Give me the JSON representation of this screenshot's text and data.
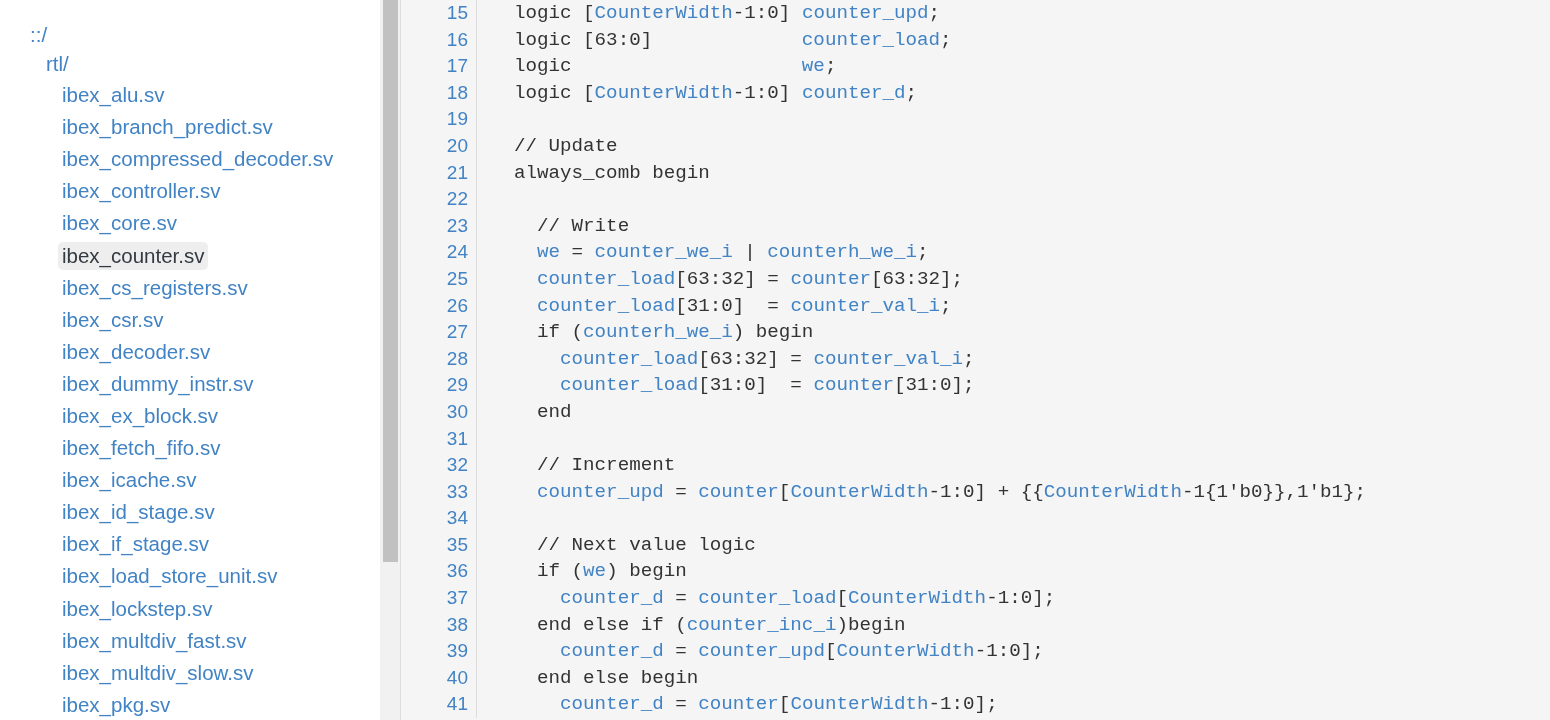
{
  "file_tree": [
    {
      "label": "::/",
      "kind": "folder",
      "selected": false,
      "children": [
        {
          "label": "rtl/",
          "kind": "folder",
          "selected": false,
          "children": [
            {
              "label": "ibex_alu.sv",
              "kind": "file",
              "selected": false
            },
            {
              "label": "ibex_branch_predict.sv",
              "kind": "file",
              "selected": false
            },
            {
              "label": "ibex_compressed_decoder.sv",
              "kind": "file",
              "selected": false
            },
            {
              "label": "ibex_controller.sv",
              "kind": "file",
              "selected": false
            },
            {
              "label": "ibex_core.sv",
              "kind": "file",
              "selected": false
            },
            {
              "label": "ibex_counter.sv",
              "kind": "file",
              "selected": true
            },
            {
              "label": "ibex_cs_registers.sv",
              "kind": "file",
              "selected": false
            },
            {
              "label": "ibex_csr.sv",
              "kind": "file",
              "selected": false
            },
            {
              "label": "ibex_decoder.sv",
              "kind": "file",
              "selected": false
            },
            {
              "label": "ibex_dummy_instr.sv",
              "kind": "file",
              "selected": false
            },
            {
              "label": "ibex_ex_block.sv",
              "kind": "file",
              "selected": false
            },
            {
              "label": "ibex_fetch_fifo.sv",
              "kind": "file",
              "selected": false
            },
            {
              "label": "ibex_icache.sv",
              "kind": "file",
              "selected": false
            },
            {
              "label": "ibex_id_stage.sv",
              "kind": "file",
              "selected": false
            },
            {
              "label": "ibex_if_stage.sv",
              "kind": "file",
              "selected": false
            },
            {
              "label": "ibex_load_store_unit.sv",
              "kind": "file",
              "selected": false
            },
            {
              "label": "ibex_lockstep.sv",
              "kind": "file",
              "selected": false
            },
            {
              "label": "ibex_multdiv_fast.sv",
              "kind": "file",
              "selected": false
            },
            {
              "label": "ibex_multdiv_slow.sv",
              "kind": "file",
              "selected": false
            },
            {
              "label": "ibex_pkg.sv",
              "kind": "file",
              "selected": false
            }
          ]
        }
      ]
    }
  ],
  "code": [
    {
      "number": "15",
      "tokens": [
        {
          "kind": "plain",
          "text": "logic ["
        },
        {
          "kind": "name",
          "text": "CounterWidth"
        },
        {
          "kind": "plain",
          "text": "-1:0] "
        },
        {
          "kind": "name",
          "text": "counter_upd"
        },
        {
          "kind": "plain",
          "text": ";"
        }
      ]
    },
    {
      "number": "16",
      "tokens": [
        {
          "kind": "plain",
          "text": "logic [63:0]             "
        },
        {
          "kind": "name",
          "text": "counter_load"
        },
        {
          "kind": "plain",
          "text": ";"
        }
      ]
    },
    {
      "number": "17",
      "tokens": [
        {
          "kind": "plain",
          "text": "logic                    "
        },
        {
          "kind": "name",
          "text": "we"
        },
        {
          "kind": "plain",
          "text": ";"
        }
      ]
    },
    {
      "number": "18",
      "tokens": [
        {
          "kind": "plain",
          "text": "logic ["
        },
        {
          "kind": "name",
          "text": "CounterWidth"
        },
        {
          "kind": "plain",
          "text": "-1:0] "
        },
        {
          "kind": "name",
          "text": "counter_d"
        },
        {
          "kind": "plain",
          "text": ";"
        }
      ]
    },
    {
      "number": "19"
    },
    {
      "number": "20",
      "tokens": [
        {
          "kind": "plain",
          "text": "// Update"
        }
      ]
    },
    {
      "number": "21",
      "tokens": [
        {
          "kind": "plain",
          "text": "always_comb begin"
        }
      ]
    },
    {
      "number": "22"
    },
    {
      "number": "23",
      "tokens": [
        {
          "kind": "plain",
          "text": "  // Write"
        }
      ]
    },
    {
      "number": "24",
      "tokens": [
        {
          "kind": "name",
          "text": "  we"
        },
        {
          "kind": "plain",
          "text": " = "
        },
        {
          "kind": "name",
          "text": "counter_we_i"
        },
        {
          "kind": "plain",
          "text": " | "
        },
        {
          "kind": "name",
          "text": "counterh_we_i"
        },
        {
          "kind": "plain",
          "text": ";"
        }
      ]
    },
    {
      "number": "25",
      "tokens": [
        {
          "kind": "name",
          "text": "  counter_load"
        },
        {
          "kind": "plain",
          "text": "[63:32] = "
        },
        {
          "kind": "name",
          "text": "counter"
        },
        {
          "kind": "plain",
          "text": "[63:32];"
        }
      ]
    },
    {
      "number": "26",
      "tokens": [
        {
          "kind": "name",
          "text": "  counter_load"
        },
        {
          "kind": "plain",
          "text": "[31:0]  = "
        },
        {
          "kind": "name",
          "text": "counter_val_i"
        },
        {
          "kind": "plain",
          "text": ";"
        }
      ]
    },
    {
      "number": "27",
      "tokens": [
        {
          "kind": "plain",
          "text": "  if ("
        },
        {
          "kind": "name",
          "text": "counterh_we_i"
        },
        {
          "kind": "plain",
          "text": ") begin"
        }
      ]
    },
    {
      "number": "28",
      "tokens": [
        {
          "kind": "name",
          "text": "    counter_load"
        },
        {
          "kind": "plain",
          "text": "[63:32] = "
        },
        {
          "kind": "name",
          "text": "counter_val_i"
        },
        {
          "kind": "plain",
          "text": ";"
        }
      ]
    },
    {
      "number": "29",
      "tokens": [
        {
          "kind": "name",
          "text": "    counter_load"
        },
        {
          "kind": "plain",
          "text": "[31:0]  = "
        },
        {
          "kind": "name",
          "text": "counter"
        },
        {
          "kind": "plain",
          "text": "[31:0];"
        }
      ]
    },
    {
      "number": "30",
      "tokens": [
        {
          "kind": "plain",
          "text": "  end"
        }
      ]
    },
    {
      "number": "31"
    },
    {
      "number": "32",
      "tokens": [
        {
          "kind": "plain",
          "text": "  // Increment"
        }
      ]
    },
    {
      "number": "33",
      "tokens": [
        {
          "kind": "name",
          "text": "  counter_upd"
        },
        {
          "kind": "plain",
          "text": " = "
        },
        {
          "kind": "name",
          "text": "counter"
        },
        {
          "kind": "plain",
          "text": "["
        },
        {
          "kind": "name",
          "text": "CounterWidth"
        },
        {
          "kind": "plain",
          "text": "-1:0] + {{"
        },
        {
          "kind": "name",
          "text": "CounterWidth"
        },
        {
          "kind": "plain",
          "text": "-1{1'b0}},1'b1};"
        }
      ]
    },
    {
      "number": "34"
    },
    {
      "number": "35",
      "tokens": [
        {
          "kind": "plain",
          "text": "  // Next value logic"
        }
      ]
    },
    {
      "number": "36",
      "tokens": [
        {
          "kind": "plain",
          "text": "  if ("
        },
        {
          "kind": "name",
          "text": "we"
        },
        {
          "kind": "plain",
          "text": ") begin"
        }
      ]
    },
    {
      "number": "37",
      "tokens": [
        {
          "kind": "name",
          "text": "    counter_d"
        },
        {
          "kind": "plain",
          "text": " = "
        },
        {
          "kind": "name",
          "text": "counter_load"
        },
        {
          "kind": "plain",
          "text": "["
        },
        {
          "kind": "name",
          "text": "CounterWidth"
        },
        {
          "kind": "plain",
          "text": "-1:0];"
        }
      ]
    },
    {
      "number": "38",
      "tokens": [
        {
          "kind": "plain",
          "text": "  end else if ("
        },
        {
          "kind": "name",
          "text": "counter_inc_i"
        },
        {
          "kind": "plain",
          "text": ")begin"
        }
      ]
    },
    {
      "number": "39",
      "tokens": [
        {
          "kind": "name",
          "text": "    counter_d"
        },
        {
          "kind": "plain",
          "text": " = "
        },
        {
          "kind": "name",
          "text": "counter_upd"
        },
        {
          "kind": "plain",
          "text": "["
        },
        {
          "kind": "name",
          "text": "CounterWidth"
        },
        {
          "kind": "plain",
          "text": "-1:0];"
        }
      ]
    },
    {
      "number": "40",
      "tokens": [
        {
          "kind": "plain",
          "text": "  end else begin"
        }
      ]
    },
    {
      "number": "41",
      "tokens": [
        {
          "kind": "name",
          "text": "    counter_d"
        },
        {
          "kind": "plain",
          "text": " = "
        },
        {
          "kind": "name",
          "text": "counter"
        },
        {
          "kind": "plain",
          "text": "["
        },
        {
          "kind": "name",
          "text": "CounterWidth"
        },
        {
          "kind": "plain",
          "text": "-1:0];"
        }
      ]
    }
  ]
}
